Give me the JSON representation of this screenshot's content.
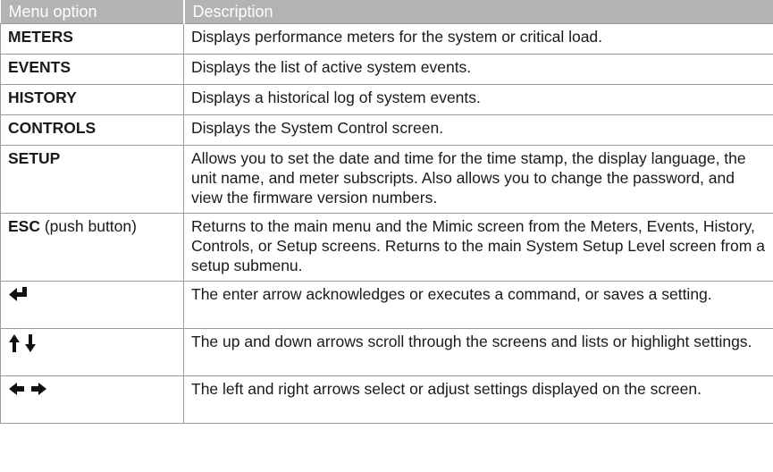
{
  "header": {
    "col1": "Menu option",
    "col2": "Description"
  },
  "rows": [
    {
      "option": "METERS",
      "description": "Displays performance meters for the system or critical load."
    },
    {
      "option": "EVENTS",
      "description": "Displays the list of active system events."
    },
    {
      "option": "HISTORY",
      "description": "Displays a historical log of system events."
    },
    {
      "option": "CONTROLS",
      "description": "Displays the System Control screen."
    },
    {
      "option": "SETUP",
      "description": "Allows you to set the date and time for the time stamp, the display language, the unit name, and meter subscripts. Also allows you to change the password, and view the firmware version numbers."
    },
    {
      "option": "ESC",
      "option_suffix": " (push button)",
      "description": "Returns to the main menu and the Mimic screen from the Meters, Events, History, Controls, or Setup screens. Returns to the main System Setup Level screen from a setup submenu."
    },
    {
      "icon": "enter-arrow-icon",
      "description": "The enter arrow acknowledges or executes a command, or saves a setting."
    },
    {
      "icon": "up-down-arrows-icon",
      "description": "The up and down arrows scroll through the screens and lists or highlight settings."
    },
    {
      "icon": "left-right-arrows-icon",
      "description": "The left and right arrows select or adjust settings displayed on the screen."
    }
  ],
  "colors": {
    "header_bg": "#b3b3b3",
    "header_text": "#ffffff",
    "border": "#9a9a9a"
  }
}
